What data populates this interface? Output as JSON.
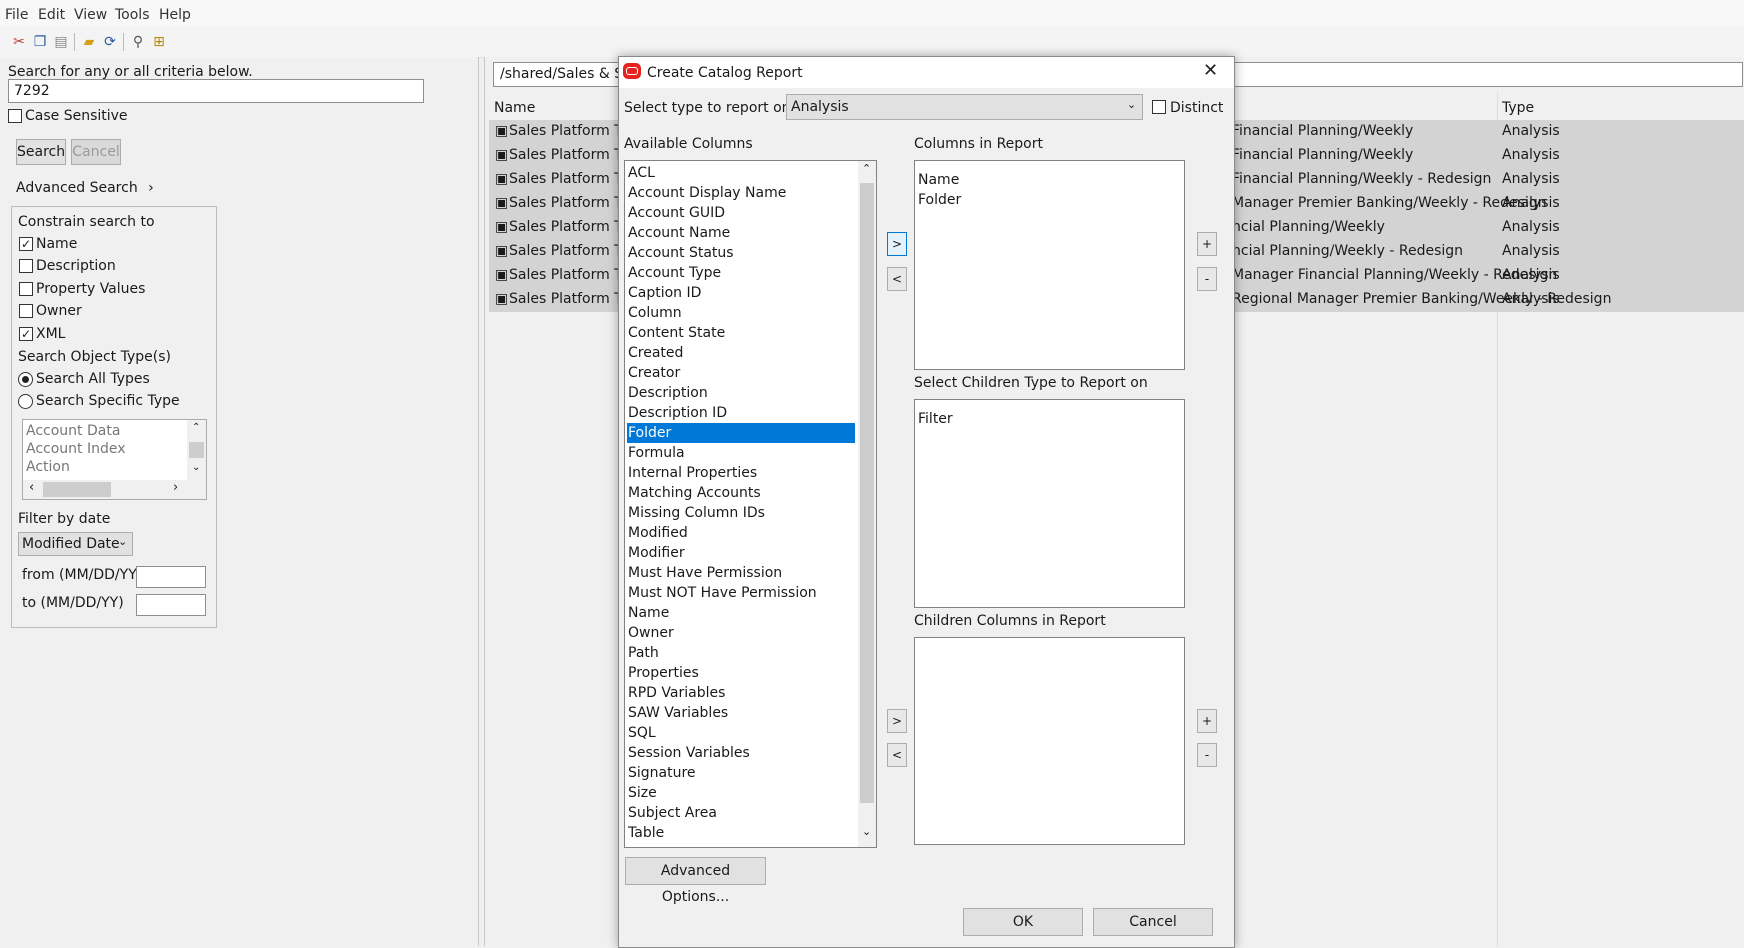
{
  "menu": [
    "File",
    "Edit",
    "View",
    "Tools",
    "Help"
  ],
  "toolbar_icons": [
    "cut-icon",
    "copy-icon",
    "paste-icon",
    "new-folder-icon",
    "refresh-icon",
    "find-icon",
    "tree-icon"
  ],
  "search": {
    "prompt": "Search for any or all criteria below.",
    "value": "7292",
    "case_sensitive_label": "Case Sensitive",
    "search_button": "Search",
    "cancel_button": "Cancel",
    "advanced_label": "Advanced Search",
    "constrain_label": "Constrain search to",
    "constraints": [
      {
        "label": "Name",
        "checked": true
      },
      {
        "label": "Description",
        "checked": false
      },
      {
        "label": "Property Values",
        "checked": false
      },
      {
        "label": "Owner",
        "checked": false
      },
      {
        "label": "XML",
        "checked": true
      }
    ],
    "object_types_label": "Search Object Type(s)",
    "all_types_label": "Search All Types",
    "specific_type_label": "Search Specific Type",
    "type_list": [
      "Account Data",
      "Account Index",
      "Action"
    ],
    "filter_date_label": "Filter by date",
    "date_field": "Modified Date",
    "from_label": "from (MM/DD/YY)",
    "to_label": "to (MM/DD/YY)"
  },
  "results": {
    "path": "/shared/Sales & S",
    "col_name": "Name",
    "col_type": "Type",
    "rows": [
      {
        "name": "Sales Platform Ta",
        "path": "Financial Planning/Weekly",
        "type": "Analysis"
      },
      {
        "name": "Sales Platform Ta",
        "path": "Financial Planning/Weekly",
        "type": "Analysis"
      },
      {
        "name": "Sales Platform Ta",
        "path": "Financial Planning/Weekly - Redesign",
        "type": "Analysis"
      },
      {
        "name": "Sales Platform Ta",
        "path": "Manager Premier Banking/Weekly - Redesign",
        "type": "Analysis"
      },
      {
        "name": "Sales Platform Ta",
        "path": "ncial Planning/Weekly",
        "type": "Analysis"
      },
      {
        "name": "Sales Platform Ta",
        "path": "ncial Planning/Weekly - Redesign",
        "type": "Analysis"
      },
      {
        "name": "Sales Platform Ta",
        "path": "Manager Financial Planning/Weekly - Redesign",
        "type": "Analysis"
      },
      {
        "name": "Sales Platform Ta",
        "path": "Regional Manager Premier Banking/Weekly - Redesign",
        "type": "Analysis"
      }
    ]
  },
  "dialog": {
    "title": "Create Catalog Report",
    "type_label": "Select type to report on",
    "type_value": "Analysis",
    "distinct_label": "Distinct",
    "available_label": "Available Columns",
    "available": [
      "ACL",
      "Account Display Name",
      "Account GUID",
      "Account Name",
      "Account Status",
      "Account Type",
      "Caption ID",
      "Column",
      "Content State",
      "Created",
      "Creator",
      "Description",
      "Description ID",
      "Folder",
      "Formula",
      "Internal Properties",
      "Matching Accounts",
      "Missing Column IDs",
      "Modified",
      "Modifier",
      "Must Have Permission",
      "Must NOT Have Permission",
      "Name",
      "Owner",
      "Path",
      "Properties",
      "RPD Variables",
      "SAW Variables",
      "SQL",
      "Session Variables",
      "Signature",
      "Size",
      "Subject Area",
      "Table"
    ],
    "selected_available": "Folder",
    "in_report_label": "Columns in Report",
    "in_report": [
      "Name",
      "Folder"
    ],
    "children_type_label": "Select Children Type to Report on",
    "children_types": [
      "Filter"
    ],
    "children_cols_label": "Children Columns in Report",
    "children_cols": [],
    "add_label": ">",
    "remove_label": "<",
    "plus_label": "+",
    "minus_label": "-",
    "advanced_button": "Advanced Options...",
    "ok_button": "OK",
    "cancel_button": "Cancel"
  }
}
